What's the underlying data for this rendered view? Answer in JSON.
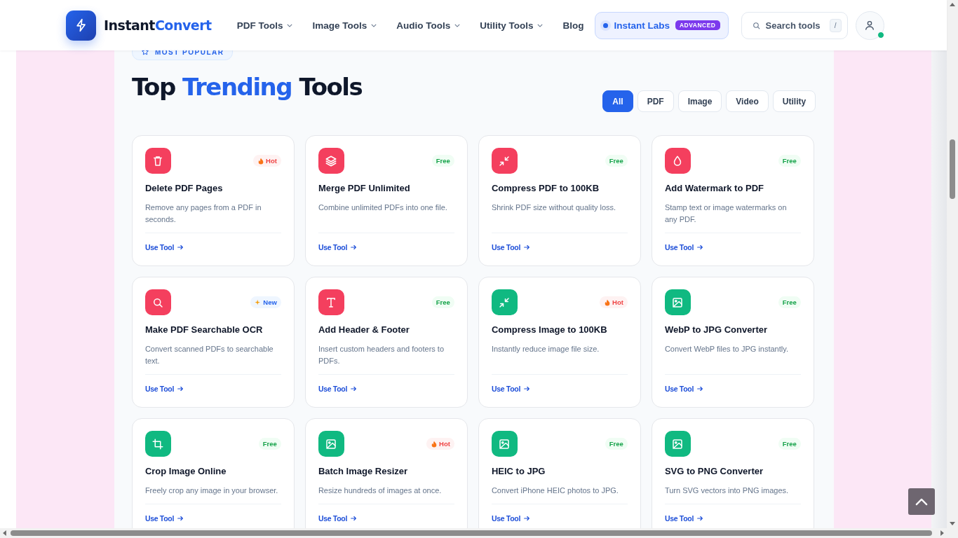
{
  "header": {
    "brand": {
      "name": "Instant",
      "accent": "Convert"
    },
    "nav": [
      {
        "label": "PDF Tools",
        "has_menu": true
      },
      {
        "label": "Image Tools",
        "has_menu": true
      },
      {
        "label": "Audio Tools",
        "has_menu": true
      },
      {
        "label": "Utility Tools",
        "has_menu": true
      },
      {
        "label": "Blog",
        "has_menu": false
      }
    ],
    "labs": {
      "label": "Instant Labs",
      "badge": "ADVANCED"
    },
    "search": {
      "placeholder": "Search tools",
      "shortcut": "/"
    },
    "user": {
      "online": true
    }
  },
  "section": {
    "eyebrow": "MOST POPULAR",
    "title": {
      "before": "Top ",
      "accent": "Trending",
      "after": " Tools"
    },
    "filters": [
      {
        "label": "All",
        "selected": true
      },
      {
        "label": "PDF",
        "selected": false
      },
      {
        "label": "Image",
        "selected": false
      },
      {
        "label": "Video",
        "selected": false
      },
      {
        "label": "Utility",
        "selected": false
      }
    ],
    "tools": [
      {
        "kind": "trash",
        "color": "#f43f5e",
        "name": "Delete PDF Pages",
        "description": "Remove any pages from a PDF in seconds.",
        "badge": {
          "kind": "hot",
          "label": "Hot"
        },
        "action": "Use Tool"
      },
      {
        "kind": "layers",
        "color": "#f43f5e",
        "name": "Merge PDF Unlimited",
        "description": "Combine unlimited PDFs into one file.",
        "badge": {
          "kind": "free",
          "label": "Free"
        },
        "action": "Use Tool"
      },
      {
        "kind": "compress",
        "color": "#f43f5e",
        "name": "Compress PDF to 100KB",
        "description": "Shrink PDF size without quality loss.",
        "badge": {
          "kind": "free",
          "label": "Free"
        },
        "action": "Use Tool"
      },
      {
        "kind": "drop",
        "color": "#f43f5e",
        "name": "Add Watermark to PDF",
        "description": "Stamp text or image watermarks on any PDF.",
        "badge": {
          "kind": "free",
          "label": "Free"
        },
        "action": "Use Tool"
      },
      {
        "kind": "search",
        "color": "#f43f5e",
        "name": "Make PDF Searchable OCR",
        "description": "Convert scanned PDFs to searchable text.",
        "badge": {
          "kind": "new",
          "label": "New"
        },
        "action": "Use Tool"
      },
      {
        "kind": "text",
        "color": "#f43f5e",
        "name": "Add Header & Footer",
        "description": "Insert custom headers and footers to PDFs.",
        "badge": {
          "kind": "free",
          "label": "Free"
        },
        "action": "Use Tool"
      },
      {
        "kind": "compress",
        "color": "#10b981",
        "name": "Compress Image to 100KB",
        "description": "Instantly reduce image file size.",
        "badge": {
          "kind": "hot",
          "label": "Hot"
        },
        "action": "Use Tool"
      },
      {
        "kind": "image",
        "color": "#10b981",
        "name": "WebP to JPG Converter",
        "description": "Convert WebP files to JPG instantly.",
        "badge": {
          "kind": "free",
          "label": "Free"
        },
        "action": "Use Tool"
      },
      {
        "kind": "crop",
        "color": "#10b981",
        "name": "Crop Image Online",
        "description": "Freely crop any image in your browser.",
        "badge": {
          "kind": "free",
          "label": "Free"
        },
        "action": "Use Tool"
      },
      {
        "kind": "image",
        "color": "#10b981",
        "name": "Batch Image Resizer",
        "description": "Resize hundreds of images at once.",
        "badge": {
          "kind": "hot",
          "label": "Hot"
        },
        "action": "Use Tool"
      },
      {
        "kind": "image",
        "color": "#10b981",
        "name": "HEIC to JPG",
        "description": "Convert iPhone HEIC photos to JPG.",
        "badge": {
          "kind": "free",
          "label": "Free"
        },
        "action": "Use Tool"
      },
      {
        "kind": "image",
        "color": "#10b981",
        "name": "SVG to PNG Converter",
        "description": "Turn SVG vectors into PNG images.",
        "badge": {
          "kind": "free",
          "label": "Free"
        },
        "action": "Use Tool"
      }
    ]
  }
}
